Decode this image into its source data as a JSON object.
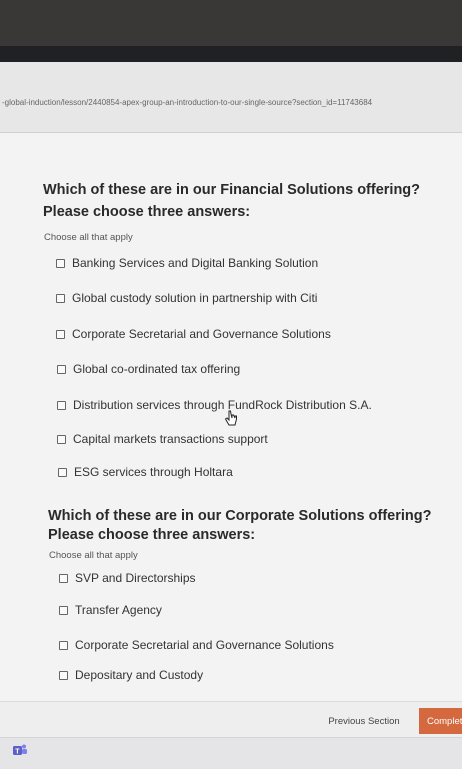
{
  "browser": {
    "url": "-global-induction/lesson/2440854-apex-group-an-introduction-to-our-single-source?section_id=11743684"
  },
  "questions": [
    {
      "title_line1": "Which of these are in our Financial Solutions offering?",
      "title_line2": "Please choose three answers:",
      "subtitle": "Choose all that apply",
      "options": [
        "Banking Services and Digital Banking Solution",
        "Global custody solution in partnership with Citi",
        "Corporate Secretarial and Governance Solutions",
        "Global co-ordinated tax offering",
        "Distribution services through FundRock Distribution S.A.",
        "Capital markets transactions support",
        "ESG services through Holtara"
      ]
    },
    {
      "title_line1": "Which of these are in our Corporate Solutions offering?",
      "title_line2": "Please choose three answers:",
      "subtitle": "Choose all that apply",
      "options": [
        "SVP and Directorships",
        "Transfer Agency",
        "Corporate Secretarial and Governance Solutions",
        "Depositary and Custody"
      ]
    }
  ],
  "footer": {
    "previous_label": "Previous Section",
    "complete_label": "Complete"
  },
  "icons": {
    "cursor": "hand-pointer-icon",
    "taskbar": "teams-icon"
  },
  "colors": {
    "accent": "#d4683f"
  }
}
